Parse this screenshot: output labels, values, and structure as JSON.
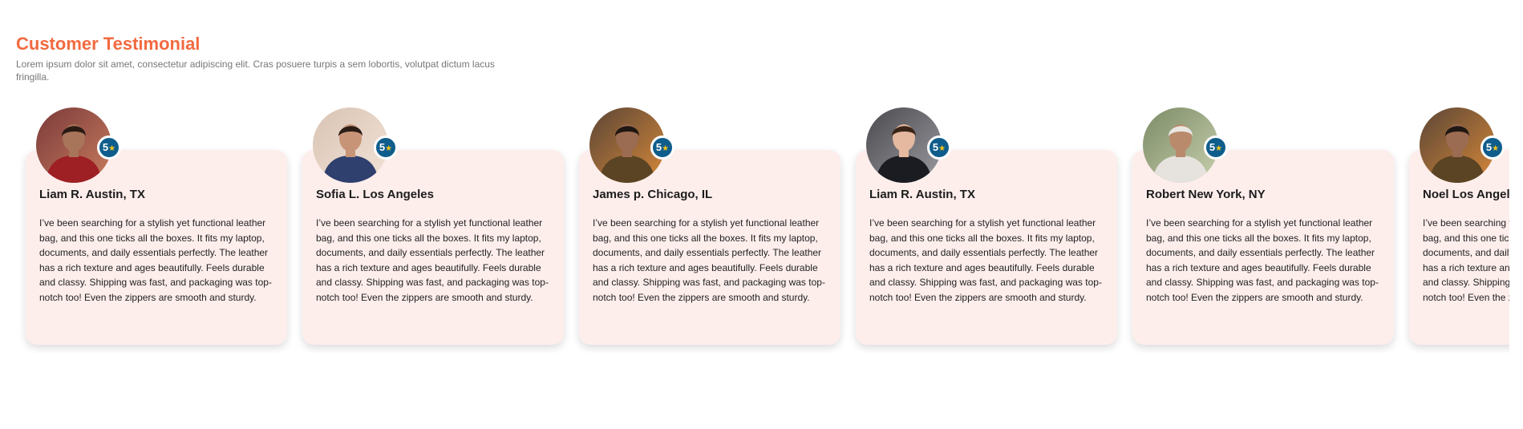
{
  "header": {
    "title": "Customer Testimonial",
    "subtitle": "Lorem ipsum dolor sit amet, consectetur adipiscing elit. Cras posuere turpis a sem lobortis, volutpat dictum lacus fringilla."
  },
  "colors": {
    "accent": "#f26a3f",
    "card_background": "#fdeeec",
    "badge": "#0f5d8c",
    "star": "#f5c518"
  },
  "testimonials": [
    {
      "name": "Liam R. Austin, TX",
      "rating": "5",
      "star_icon": "star-icon",
      "review": "I’ve been searching for a stylish yet functional leather bag, and this one ticks all the boxes. It fits my laptop, documents, and daily essentials perfectly. The leather has a rich texture and ages beautifully. Feels durable and classy. Shipping was fast, and packaging was top-notch too! Even the zippers are smooth and sturdy."
    },
    {
      "name": "Sofia L. Los Angeles",
      "rating": "5",
      "star_icon": "star-icon",
      "review": "I’ve been searching for a stylish yet functional leather bag, and this one ticks all the boxes. It fits my laptop, documents, and daily essentials perfectly. The leather has a rich texture and ages beautifully. Feels durable and classy. Shipping was fast, and packaging was top-notch too! Even the zippers are smooth and sturdy."
    },
    {
      "name": "James p. Chicago, IL",
      "rating": "5",
      "star_icon": "star-icon",
      "review": "I’ve been searching for a stylish yet functional leather bag, and this one ticks all the boxes. It fits my laptop, documents, and daily essentials perfectly. The leather has a rich texture and ages beautifully. Feels durable and classy. Shipping was fast, and packaging was top-notch too! Even the zippers are smooth and sturdy."
    },
    {
      "name": "Liam R. Austin, TX",
      "rating": "5",
      "star_icon": "star-icon",
      "review": "I’ve been searching for a stylish yet functional leather bag, and this one ticks all the boxes. It fits my laptop, documents, and daily essentials perfectly. The leather has a rich texture and ages beautifully. Feels durable and classy. Shipping was fast, and packaging was top-notch too! Even the zippers are smooth and sturdy."
    },
    {
      "name": "Robert New York, NY",
      "rating": "5",
      "star_icon": "star-icon",
      "review": "I’ve been searching for a stylish yet functional leather bag, and this one ticks all the boxes. It fits my laptop, documents, and daily essentials perfectly. The leather has a rich texture and ages beautifully. Feels durable and classy. Shipping was fast, and packaging was top-notch too! Even the zippers are smooth and sturdy."
    },
    {
      "name": "Noel Los Angeles",
      "rating": "5",
      "star_icon": "star-icon",
      "review": "I’ve been searching for a stylish yet functional leather bag, and this one ticks all the boxes. It fits my laptop, documents, and daily essentials perfectly. The leather has a rich texture and ages beautifully. Feels durable and classy. Shipping was fast, and packaging was top-notch too! Even the zippers are smooth and sturdy."
    }
  ]
}
